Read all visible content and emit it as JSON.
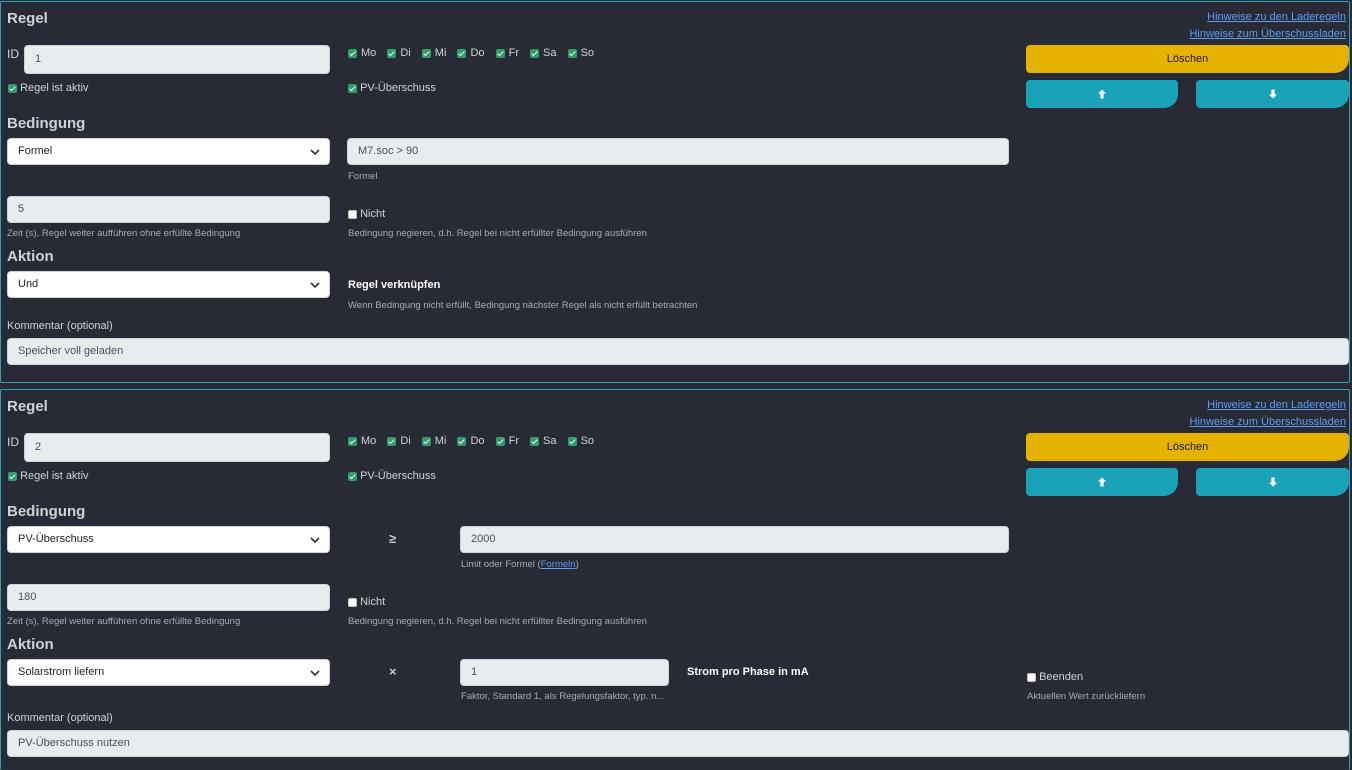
{
  "rules": [
    {
      "title": "Regel",
      "link1": "Hinweise zu den Laderegeln",
      "link2": "Hinweise zum Überschussladen",
      "id_label": "ID",
      "id_value": "1",
      "active_label": "Regel ist aktiv",
      "days": [
        "Mo",
        "Di",
        "Mi",
        "Do",
        "Fr",
        "Sa",
        "So"
      ],
      "pv_label": "PV-Überschuss",
      "delete_label": "Löschen",
      "condition_heading": "Bedingung",
      "condition_select": "Formel",
      "formula_value": "M7.soc > 90",
      "formula_help": "Formel",
      "time_value": "5",
      "time_help": "Zeit (s), Regel weiter aufführen ohne erfüllte Bedingung",
      "not_label": "Nicht",
      "not_help": "Bedingung negieren, d.h. Regel bei nicht erfüllter Bedingung ausführen",
      "action_heading": "Aktion",
      "action_select": "Und",
      "action_title": "Regel verknüpfen",
      "action_help": "Wenn Bedingung nicht erfüllt, Bedingung nächster Regel als nicht erfüllt betrachten",
      "comment_label": "Kommentar (optional)",
      "comment_value": "Speicher voll geladen"
    },
    {
      "title": "Regel",
      "link1": "Hinweise zu den Laderegeln",
      "link2": "Hinweise zum Überschussladen",
      "id_label": "ID",
      "id_value": "2",
      "active_label": "Regel ist aktiv",
      "days": [
        "Mo",
        "Di",
        "Mi",
        "Do",
        "Fr",
        "Sa",
        "So"
      ],
      "pv_label": "PV-Überschuss",
      "delete_label": "Löschen",
      "condition_heading": "Bedingung",
      "condition_select": "PV-Überschuss",
      "operator": "≥",
      "limit_value": "2000",
      "limit_help_prefix": "Limit oder Formel (",
      "limit_help_link": "Formeln",
      "limit_help_suffix": ")",
      "time_value": "180",
      "time_help": "Zeit (s), Regel weiter aufführen ohne erfüllte Bedingung",
      "not_label": "Nicht",
      "not_help": "Bedingung negieren, d.h. Regel bei nicht erfüllter Bedingung ausführen",
      "action_heading": "Aktion",
      "action_select": "Solarstrom liefern",
      "action_operator": "×",
      "factor_value": "1",
      "factor_help": "Faktor, Standard 1, als Regelungsfaktor, typ. n...",
      "action_title": "Strom pro Phase in mA",
      "end_label": "Beenden",
      "end_help": "Aktuellen Wert zurückliefern",
      "comment_label": "Kommentar (optional)",
      "comment_value": "PV-Überschuss nutzen"
    }
  ],
  "colors": {
    "accent": "#1aa2b8",
    "delete": "#e6b200",
    "checkbox": "#2e9e6a",
    "link": "#5b9ff2",
    "background": "#282a36"
  }
}
